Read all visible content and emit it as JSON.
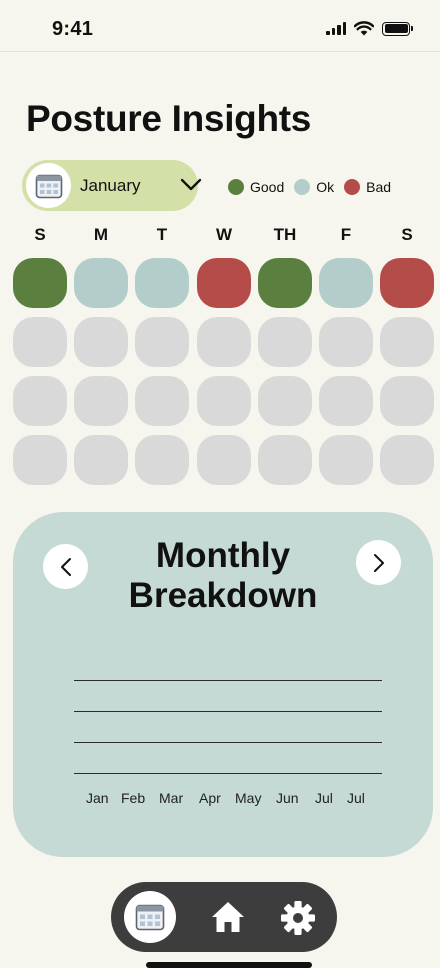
{
  "status_bar": {
    "time": "9:41"
  },
  "page": {
    "title": "Posture Insights"
  },
  "month_selector": {
    "label": "January"
  },
  "legend": [
    {
      "label": "Good",
      "color": "#5a7f3e"
    },
    {
      "label": "Ok",
      "color": "#b3ceca"
    },
    {
      "label": "Bad",
      "color": "#b44d4a"
    }
  ],
  "colors": {
    "good": "#5a7f3e",
    "ok": "#b3ceca",
    "bad": "#b44d4a",
    "empty": "#d9d9d9",
    "accent_pill": "#d3e0a8",
    "card": "#c5d9d5",
    "nav_bar": "#3d3d3d"
  },
  "calendar": {
    "weekdays": [
      "S",
      "M",
      "T",
      "W",
      "TH",
      "F",
      "S"
    ],
    "weeks": [
      [
        "good",
        "ok",
        "ok",
        "bad",
        "good",
        "ok",
        "bad"
      ],
      [
        "empty",
        "empty",
        "empty",
        "empty",
        "empty",
        "empty",
        "empty"
      ],
      [
        "empty",
        "empty",
        "empty",
        "empty",
        "empty",
        "empty",
        "empty"
      ],
      [
        "empty",
        "empty",
        "empty",
        "empty",
        "empty",
        "empty",
        "empty"
      ]
    ]
  },
  "breakdown": {
    "title_line1": "Monthly",
    "title_line2": "Breakdown",
    "months": [
      "Jan",
      "Feb",
      "Mar",
      "Apr",
      "May",
      "Jun",
      "Jul",
      "Jul"
    ]
  },
  "nav": {
    "items": [
      {
        "icon": "calendar-icon",
        "active": true
      },
      {
        "icon": "home-icon",
        "active": false
      },
      {
        "icon": "gear-icon",
        "active": false
      }
    ]
  }
}
